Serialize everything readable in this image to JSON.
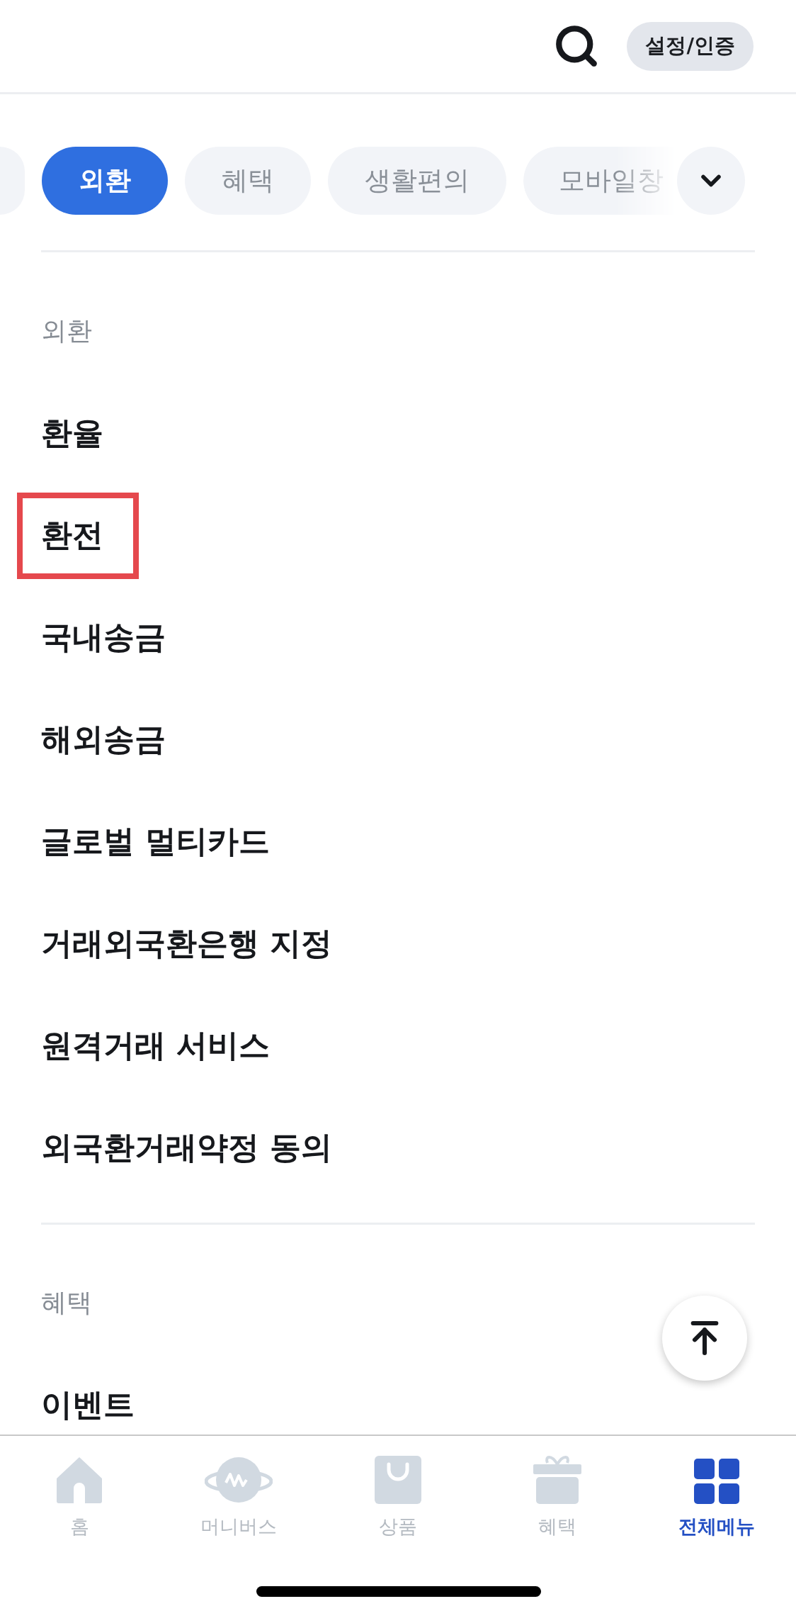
{
  "header": {
    "settings_button": "설정/인증"
  },
  "chips": [
    {
      "kind": "cut",
      "selected": false
    },
    {
      "kind": "full",
      "label": "외환",
      "selected": true
    },
    {
      "kind": "full",
      "label": "혜택",
      "selected": false
    },
    {
      "kind": "full",
      "label": "생활편의",
      "selected": false
    },
    {
      "kind": "faded",
      "label": "모바일창",
      "selected": false
    }
  ],
  "sections": [
    {
      "title": "외환",
      "items": [
        {
          "label": "환율",
          "highlighted": false
        },
        {
          "label": "환전",
          "highlighted": true
        },
        {
          "label": "국내송금",
          "highlighted": false
        },
        {
          "label": "해외송금",
          "highlighted": false
        },
        {
          "label": "글로벌 멀티카드",
          "highlighted": false
        },
        {
          "label": "거래외국환은행 지정",
          "highlighted": false
        },
        {
          "label": "원격거래 서비스",
          "highlighted": false
        },
        {
          "label": "외국환거래약정 동의",
          "highlighted": false
        }
      ]
    },
    {
      "title": "혜택",
      "items": [
        {
          "label": "이벤트",
          "highlighted": false
        }
      ]
    }
  ],
  "bottom_nav": [
    {
      "kind": "home",
      "label": "홈",
      "selected": false
    },
    {
      "kind": "planet",
      "label": "머니버스",
      "selected": false
    },
    {
      "kind": "bag",
      "label": "상품",
      "selected": false
    },
    {
      "kind": "gift",
      "label": "혜택",
      "selected": false
    },
    {
      "kind": "grid",
      "label": "전체메뉴",
      "selected": true
    }
  ]
}
